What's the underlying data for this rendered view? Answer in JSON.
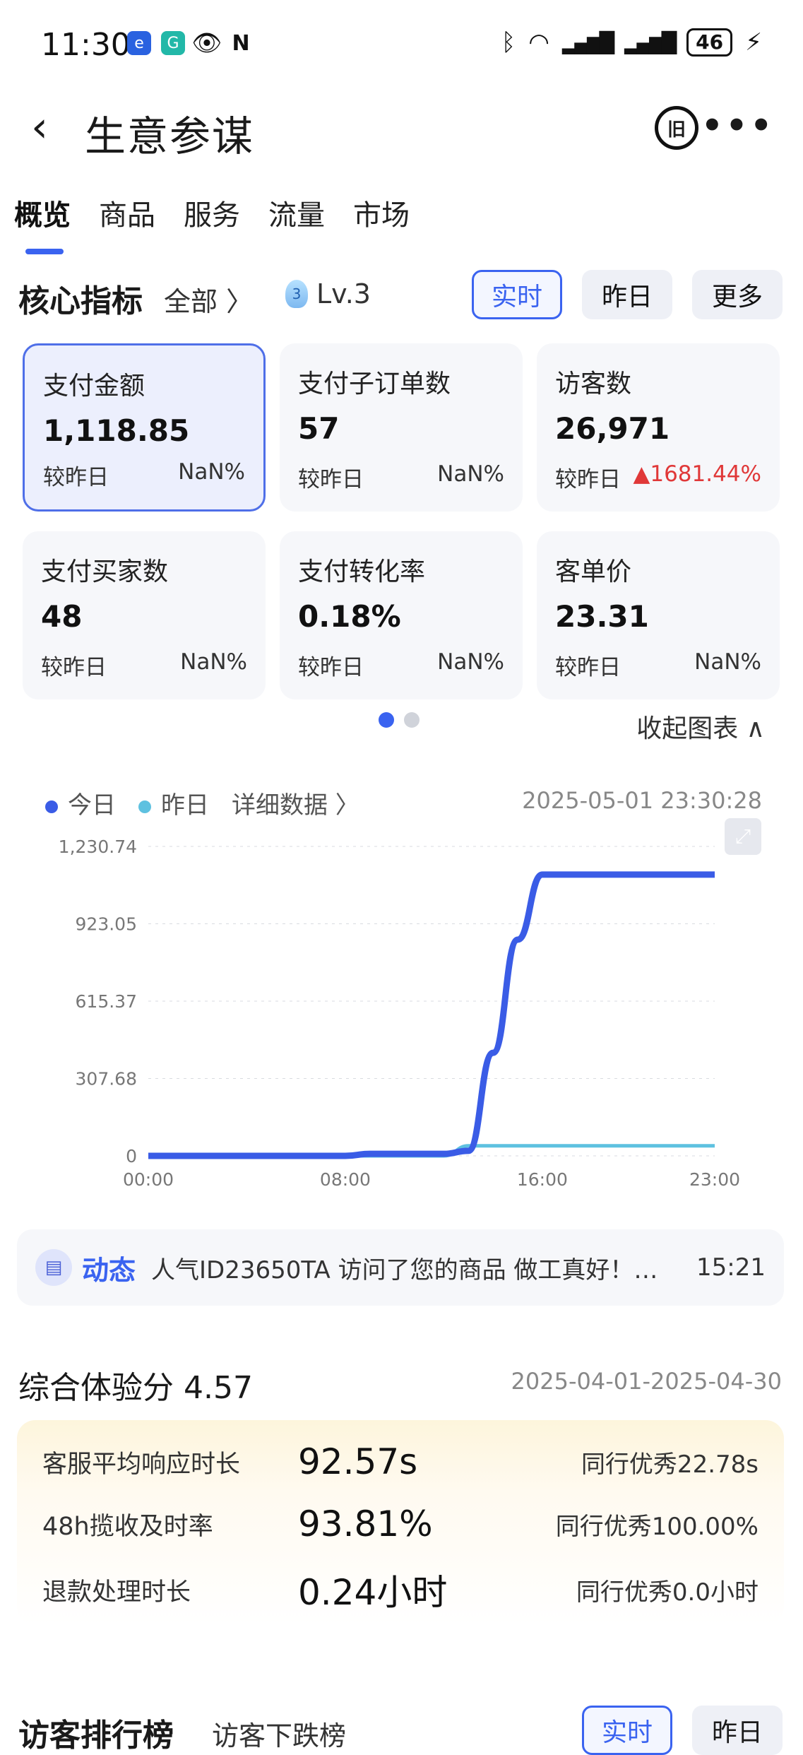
{
  "status": {
    "time": "11:30",
    "battery": "46"
  },
  "header": {
    "title": "生意参谋",
    "back_icon": "chevron-left-icon",
    "more": "•••",
    "history_icon_text": "旧"
  },
  "tabs": [
    {
      "label": "概览",
      "active": true
    },
    {
      "label": "商品"
    },
    {
      "label": "服务"
    },
    {
      "label": "流量"
    },
    {
      "label": "市场"
    }
  ],
  "core": {
    "title": "核心指标",
    "filter": "全部 〉",
    "level": "Lv.3",
    "level_badge": "3",
    "range_buttons": {
      "realtime": "实时",
      "yesterday": "昨日",
      "more": "更多"
    },
    "compare_label": "较昨日",
    "cards": [
      {
        "label": "支付金额",
        "value": "1,118.85",
        "change": "NaN%"
      },
      {
        "label": "支付子订单数",
        "value": "57",
        "change": "NaN%"
      },
      {
        "label": "访客数",
        "value": "26,971",
        "change": "▲1681.44%"
      },
      {
        "label": "支付买家数",
        "value": "48",
        "change": "NaN%"
      },
      {
        "label": "支付转化率",
        "value": "0.18%",
        "change": "NaN%"
      },
      {
        "label": "客单价",
        "value": "23.31",
        "change": "NaN%"
      }
    ],
    "collapse": "收起图表 ∧"
  },
  "chart_legend": {
    "today": "今日",
    "yesterday": "昨日",
    "detail": "详细数据 〉",
    "timestamp": "2025-05-01 23:30:28"
  },
  "chart_data": {
    "type": "line",
    "x": [
      "00:00",
      "01:00",
      "02:00",
      "03:00",
      "04:00",
      "05:00",
      "06:00",
      "07:00",
      "08:00",
      "09:00",
      "10:00",
      "11:00",
      "12:00",
      "13:00",
      "14:00",
      "15:00",
      "16:00",
      "17:00",
      "18:00",
      "19:00",
      "20:00",
      "21:00",
      "22:00",
      "23:00"
    ],
    "x_tick_labels": [
      "00:00",
      "08:00",
      "16:00",
      "23:00"
    ],
    "y_tick_labels": [
      "1,230.74",
      "923.05",
      "615.37",
      "307.68",
      "0"
    ],
    "ylim": [
      0,
      1230.74
    ],
    "series": [
      {
        "name": "今日",
        "color": "#3a5ce6",
        "values": [
          0,
          0,
          0,
          0,
          0,
          0,
          0,
          0,
          0,
          8,
          8,
          8,
          8,
          20,
          410,
          860,
          1118.85,
          1118.85,
          1118.85,
          1118.85,
          1118.85,
          1118.85,
          1118.85,
          1118.85
        ]
      },
      {
        "name": "昨日",
        "color": "#5ec1e0",
        "values": [
          0,
          0,
          0,
          0,
          0,
          0,
          0,
          0,
          0,
          0,
          0,
          0,
          0,
          40,
          40,
          40,
          40,
          40,
          40,
          40,
          40,
          40,
          40,
          40
        ]
      }
    ],
    "grid": true
  },
  "news": {
    "tag": "动态",
    "text": "人气ID23650TA 访问了您的商品 做工真好！小...",
    "time": "15:21"
  },
  "score": {
    "title": "综合体验分 4.57",
    "range": "2025-04-01-2025-04-30",
    "rows": [
      {
        "label": "客服平均响应时长",
        "value": "92.57s",
        "peer": "同行优秀22.78s"
      },
      {
        "label": "48h揽收及时率",
        "value": "93.81%",
        "peer": "同行优秀100.00%"
      },
      {
        "label": "退款处理时长",
        "value": "0.24小时",
        "peer": "同行优秀0.0小时"
      }
    ]
  },
  "bottom": {
    "title": "访客排行榜",
    "sub": "访客下跌榜",
    "realtime": "实时",
    "yesterday": "昨日"
  }
}
